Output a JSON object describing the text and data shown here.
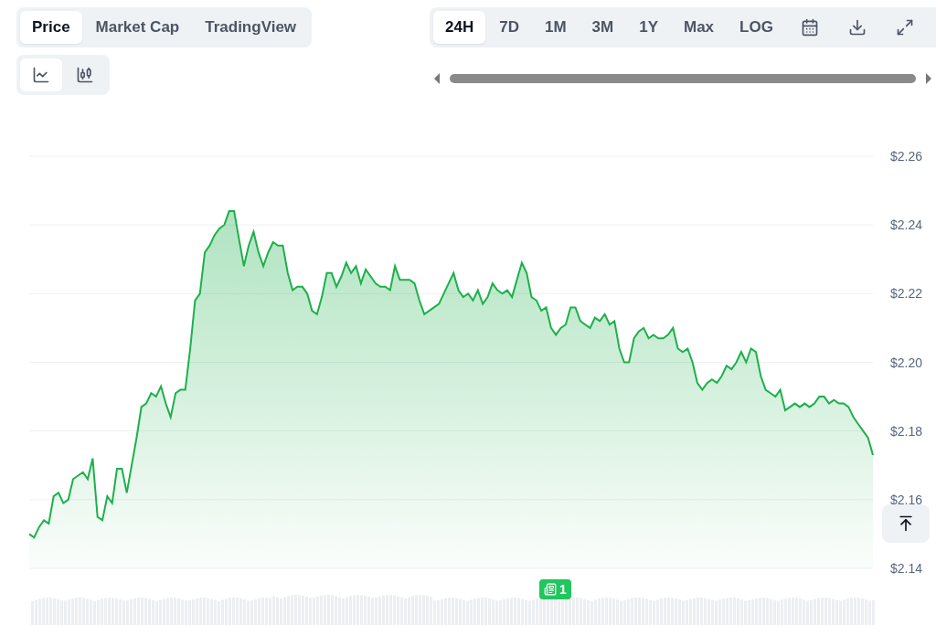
{
  "data_tabs": [
    {
      "label": "Price",
      "selected": true
    },
    {
      "label": "Market Cap",
      "selected": false
    },
    {
      "label": "TradingView",
      "selected": false
    }
  ],
  "chart_types": [
    {
      "kind": "line",
      "selected": true
    },
    {
      "kind": "candlestick",
      "selected": false
    }
  ],
  "ranges": [
    {
      "label": "24H",
      "selected": true
    },
    {
      "label": "7D",
      "selected": false
    },
    {
      "label": "1M",
      "selected": false
    },
    {
      "label": "3M",
      "selected": false
    },
    {
      "label": "1Y",
      "selected": false
    },
    {
      "label": "Max",
      "selected": false
    },
    {
      "label": "LOG",
      "selected": false
    }
  ],
  "news_badge": {
    "count": "1"
  },
  "chart": {
    "chart_data": {
      "type": "area",
      "ylim": [
        2.14,
        2.26
      ],
      "grid": true,
      "yticks": [
        {
          "value": 2.26,
          "label": "$2.26"
        },
        {
          "value": 2.24,
          "label": "$2.24"
        },
        {
          "value": 2.22,
          "label": "$2.22"
        },
        {
          "value": 2.2,
          "label": "$2.20"
        },
        {
          "value": 2.18,
          "label": "$2.18"
        },
        {
          "value": 2.16,
          "label": "$2.16"
        },
        {
          "value": 2.14,
          "label": "$2.14"
        }
      ],
      "series": [
        {
          "color": "#1db04b",
          "values": [
            2.15,
            2.149,
            2.152,
            2.154,
            2.153,
            2.161,
            2.162,
            2.159,
            2.16,
            2.166,
            2.167,
            2.168,
            2.166,
            2.172,
            2.155,
            2.154,
            2.161,
            2.159,
            2.169,
            2.169,
            2.162,
            2.17,
            2.178,
            2.187,
            2.188,
            2.191,
            2.19,
            2.193,
            2.188,
            2.184,
            2.191,
            2.192,
            2.192,
            2.204,
            2.218,
            2.22,
            2.232,
            2.234,
            2.237,
            2.239,
            2.24,
            2.244,
            2.244,
            2.236,
            2.228,
            2.234,
            2.238,
            2.232,
            2.228,
            2.232,
            2.235,
            2.234,
            2.234,
            2.226,
            2.221,
            2.222,
            2.222,
            2.22,
            2.215,
            2.214,
            2.219,
            2.226,
            2.226,
            2.222,
            2.225,
            2.229,
            2.226,
            2.228,
            2.223,
            2.227,
            2.225,
            2.223,
            2.222,
            2.222,
            2.221,
            2.228,
            2.224,
            2.224,
            2.224,
            2.223,
            2.218,
            2.214,
            2.215,
            2.216,
            2.217,
            2.22,
            2.223,
            2.226,
            2.221,
            2.219,
            2.22,
            2.218,
            2.221,
            2.217,
            2.219,
            2.223,
            2.221,
            2.22,
            2.221,
            2.219,
            2.224,
            2.229,
            2.226,
            2.219,
            2.218,
            2.215,
            2.216,
            2.21,
            2.208,
            2.21,
            2.211,
            2.216,
            2.216,
            2.212,
            2.211,
            2.21,
            2.213,
            2.212,
            2.214,
            2.211,
            2.212,
            2.204,
            2.2,
            2.2,
            2.207,
            2.209,
            2.21,
            2.207,
            2.208,
            2.207,
            2.207,
            2.208,
            2.21,
            2.204,
            2.203,
            2.204,
            2.2,
            2.194,
            2.192,
            2.194,
            2.195,
            2.194,
            2.196,
            2.199,
            2.198,
            2.2,
            2.203,
            2.2,
            2.204,
            2.203,
            2.196,
            2.192,
            2.191,
            2.19,
            2.192,
            2.186,
            2.187,
            2.188,
            2.187,
            2.188,
            2.187,
            2.188,
            2.19,
            2.19,
            2.188,
            2.189,
            2.188,
            2.188,
            2.187,
            2.184,
            2.182,
            2.18,
            2.178,
            2.173
          ]
        }
      ]
    }
  }
}
